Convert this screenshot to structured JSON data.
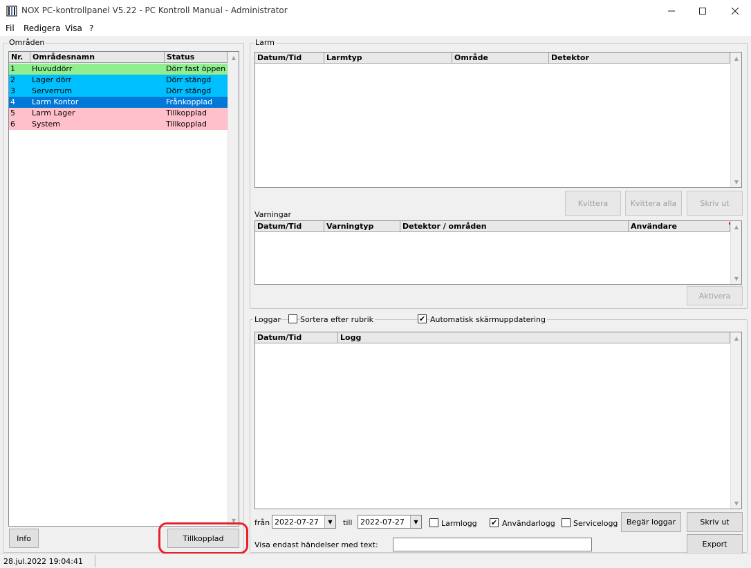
{
  "window": {
    "title": "NOX PC-kontrollpanel V5.22 - PC Kontroll Manual - Administrator",
    "minimize_icon": "minimize-icon",
    "maximize_icon": "maximize-icon",
    "close_icon": "close-icon"
  },
  "menu": [
    "Fil",
    "Redigera",
    "Visa",
    "?"
  ],
  "areas": {
    "label": "Områden",
    "columns": [
      "Nr.",
      "Områdesnamn",
      "Status"
    ],
    "rows": [
      {
        "nr": "1",
        "name": "Huvuddörr",
        "status": "Dörr fast öppen",
        "color": "#90ee90"
      },
      {
        "nr": "2",
        "name": "Lager dörr",
        "status": "Dörr stängd",
        "color": "#00bfff"
      },
      {
        "nr": "3",
        "name": "Serverrum",
        "status": "Dörr stängd",
        "color": "#00bfff"
      },
      {
        "nr": "4",
        "name": "Larm Kontor",
        "status": "Frånkopplad",
        "color": "#0078d7"
      },
      {
        "nr": "5",
        "name": "Larm Lager",
        "status": "Tillkopplad",
        "color": "#ffc0cb"
      },
      {
        "nr": "6",
        "name": "System",
        "status": "Tillkopplad",
        "color": "#ffc0cb"
      }
    ],
    "info_button": "Info",
    "toggle_button": "Tillkopplad",
    "highlight_color": "#e8202a"
  },
  "alarm": {
    "label": "Larm",
    "columns": [
      "Datum/Tid",
      "Larmtyp",
      "Område",
      "Detektor"
    ],
    "buttons": {
      "ack": "Kvittera",
      "ack_all": "Kvittera alla",
      "print": "Skriv ut"
    }
  },
  "warnings": {
    "label": "Varningar",
    "columns": [
      "Datum/Tid",
      "Varningtyp",
      "Detektor / områden",
      "Användare"
    ],
    "activate_button": "Aktivera"
  },
  "logs": {
    "label": "Loggar",
    "sort_label": "Sortera efter rubrik",
    "sort_checked": false,
    "auto_label": "Automatisk skärmuppdatering",
    "auto_checked": true,
    "columns": [
      "Datum/Tid",
      "Logg"
    ],
    "from_label": "från",
    "from_date": "2022-07-27",
    "to_label": "till",
    "to_date": "2022-07-27",
    "alarm_log": {
      "label": "Larmlogg",
      "checked": false
    },
    "user_log": {
      "label": "Användarlogg",
      "checked": true
    },
    "service_log": {
      "label": "Servicelogg",
      "checked": false
    },
    "request_button": "Begär loggar",
    "print_button": "Skriv ut",
    "export_button": "Export",
    "filter_label": "Visa endast händelser med text:",
    "filter_value": ""
  },
  "status": {
    "datetime": "28.jul.2022  19:04:41"
  }
}
